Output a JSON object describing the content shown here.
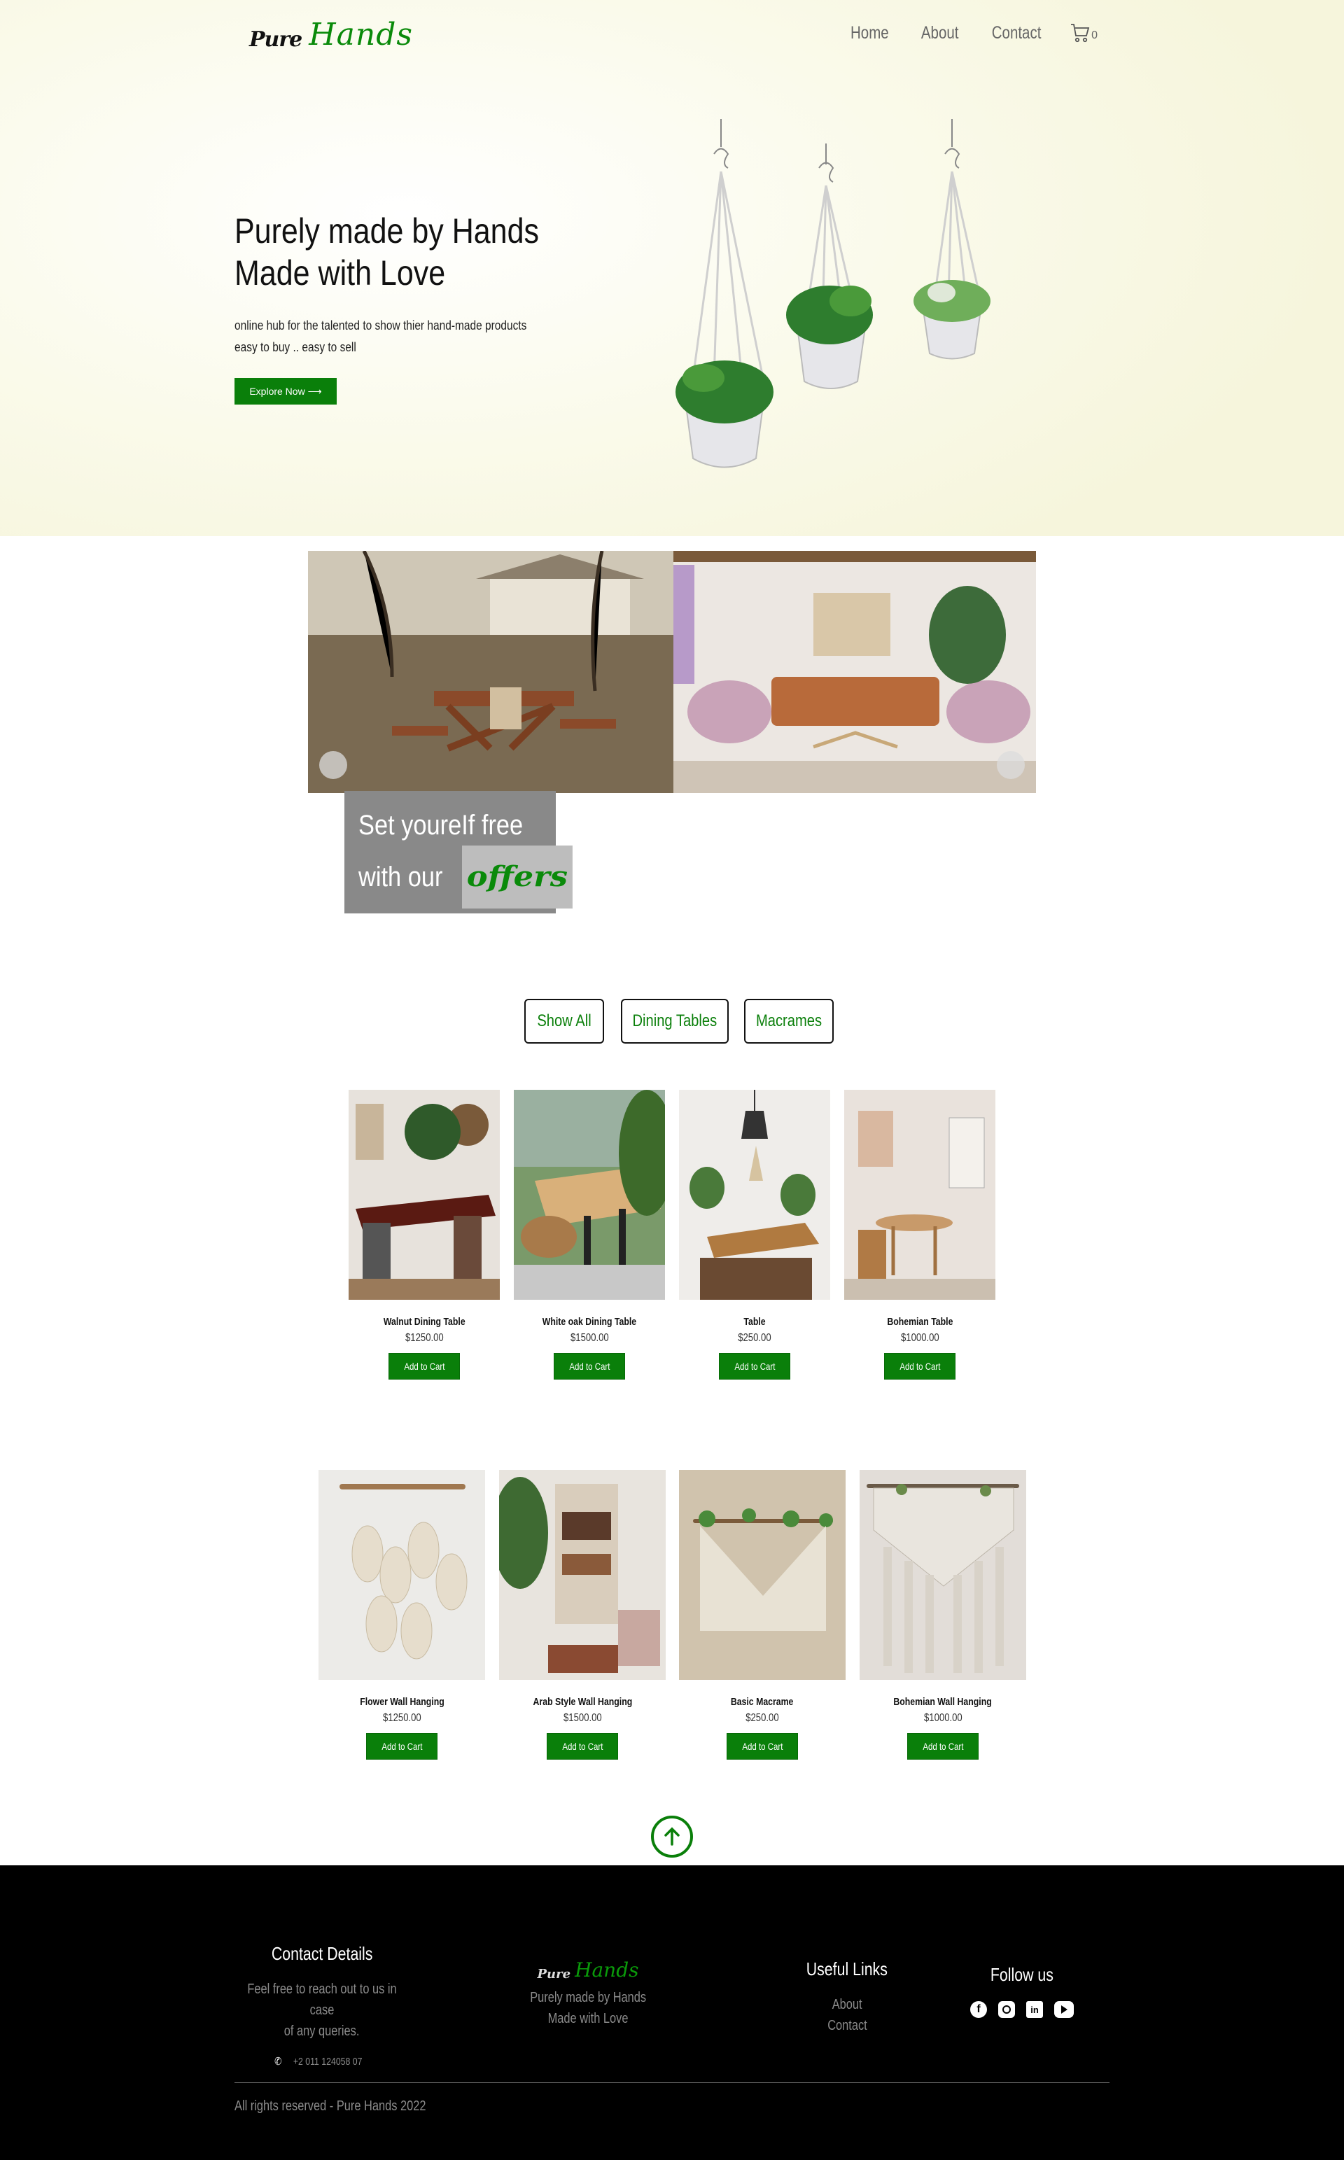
{
  "header": {
    "logo_part1": "Pure",
    "logo_part2": "Hands",
    "nav": [
      "Home",
      "About",
      "Contact"
    ],
    "cart_icon": "cart-icon",
    "cart_count": "0"
  },
  "hero": {
    "title_line1": "Purely made by Hands",
    "title_line2": "Made with Love",
    "sub_line1": "online hub for the talented to show thier hand-made products",
    "sub_line2": "easy to buy .. easy to sell",
    "cta": "Explore Now ⟶"
  },
  "offer": {
    "line1": "Set youreIf free",
    "line2": "with our",
    "highlight": "offers"
  },
  "filters": [
    "Show All",
    "Dining Tables",
    "Macrames"
  ],
  "dining": [
    {
      "name": "Walnut Dining Table",
      "price": "$1250.00"
    },
    {
      "name": "White oak Dining Table",
      "price": "$1500.00"
    },
    {
      "name": "Table",
      "price": "$250.00"
    },
    {
      "name": "Bohemian Table",
      "price": "$1000.00"
    }
  ],
  "macrames": [
    {
      "name": "Flower Wall Hanging",
      "price": "$1250.00"
    },
    {
      "name": "Arab Style Wall Hanging",
      "price": "$1500.00"
    },
    {
      "name": "Basic Macrame",
      "price": "$250.00"
    },
    {
      "name": "Bohemian Wall Hanging",
      "price": "$1000.00"
    }
  ],
  "add_to_cart": "Add to Cart",
  "footer": {
    "contact_title": "Contact Details",
    "contact_text1": "Feel free to reach out to us in case",
    "contact_text2": "of any queries.",
    "phone": "+2 011 124058 07",
    "logo_part1": "Pure",
    "logo_part2": "Hands",
    "tagline1": "Purely made by Hands",
    "tagline2": "Made with Love",
    "links_title": "Useful Links",
    "links": [
      "About",
      "Contact"
    ],
    "follow_title": "Follow us",
    "social": [
      "facebook-icon",
      "instagram-icon",
      "linkedin-icon",
      "youtube-icon"
    ],
    "copyright": "All rights reserved - Pure Hands 2022"
  },
  "colors": {
    "accent": "#0a7f0a",
    "footer_bg": "#000000",
    "hero_bg": "#f8f7e2"
  }
}
